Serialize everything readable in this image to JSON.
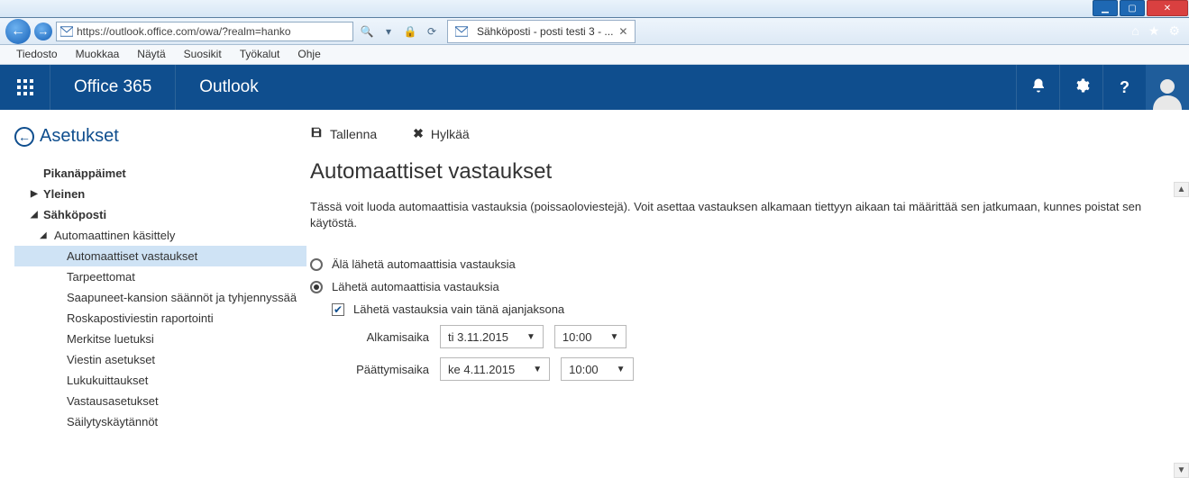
{
  "browser": {
    "url": "https://outlook.office.com/owa/?realm=hanko",
    "tab_title": "Sähköposti - posti testi 3 - ...",
    "menus": [
      "Tiedosto",
      "Muokkaa",
      "Näytä",
      "Suosikit",
      "Työkalut",
      "Ohje"
    ]
  },
  "header": {
    "brand": "Office 365",
    "app": "Outlook"
  },
  "sidebar": {
    "back_label": "Asetukset",
    "items": {
      "shortcuts": "Pikanäppäimet",
      "general": "Yleinen",
      "mail": "Sähköposti",
      "auto_processing": "Automaattinen käsittely",
      "auto_replies": "Automaattiset vastaukset",
      "clutter": "Tarpeettomat",
      "inbox_rules": "Saapuneet-kansion säännöt ja tyhjennyssää",
      "junk_reporting": "Roskapostiviestin raportointi",
      "mark_read": "Merkitse luetuksi",
      "message_options": "Viestin asetukset",
      "read_receipts": "Lukukuittaukset",
      "reply_settings": "Vastausasetukset",
      "retention": "Säilytyskäytännöt"
    }
  },
  "toolbar": {
    "save": "Tallenna",
    "discard": "Hylkää"
  },
  "page": {
    "title": "Automaattiset vastaukset",
    "description": "Tässä voit luoda automaattisia vastauksia (poissaoloviestejä). Voit asettaa vastauksen alkamaan tiettyyn aikaan tai määrittää sen jatkumaan, kunnes poistat sen käytöstä.",
    "radio_off": "Älä lähetä automaattisia vastauksia",
    "radio_on": "Lähetä automaattisia vastauksia",
    "check_period": "Lähetä vastauksia vain tänä ajanjaksona",
    "start_label": "Alkamisaika",
    "end_label": "Päättymisaika",
    "start_date": "ti 3.11.2015",
    "start_time": "10:00",
    "end_date": "ke 4.11.2015",
    "end_time": "10:00"
  }
}
